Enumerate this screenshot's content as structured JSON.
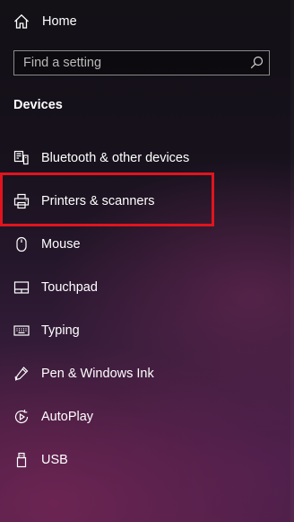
{
  "nav": {
    "home_label": "Home",
    "home_icon": "home-icon"
  },
  "search": {
    "placeholder": "Find a setting",
    "value": "",
    "icon": "search-icon"
  },
  "section": {
    "title": "Devices"
  },
  "items": [
    {
      "label": "Bluetooth & other devices",
      "icon": "bluetooth-devices-icon"
    },
    {
      "label": "Printers & scanners",
      "icon": "printer-icon",
      "highlighted": true
    },
    {
      "label": "Mouse",
      "icon": "mouse-icon"
    },
    {
      "label": "Touchpad",
      "icon": "touchpad-icon"
    },
    {
      "label": "Typing",
      "icon": "keyboard-icon"
    },
    {
      "label": "Pen & Windows Ink",
      "icon": "pen-icon"
    },
    {
      "label": "AutoPlay",
      "icon": "autoplay-icon"
    },
    {
      "label": "USB",
      "icon": "usb-icon"
    }
  ],
  "colors": {
    "text": "#ffffff",
    "highlight_border": "#e0141e",
    "search_border": "#8a8a8a"
  }
}
